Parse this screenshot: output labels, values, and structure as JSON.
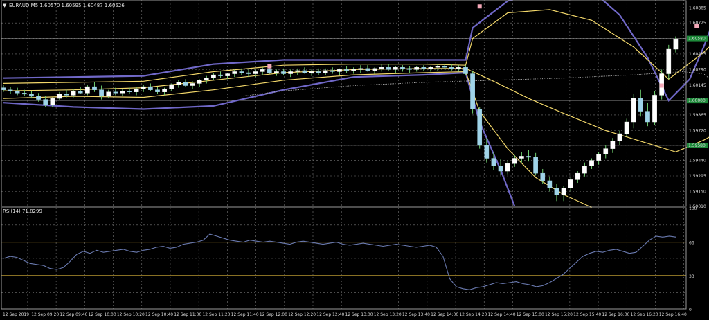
{
  "header": {
    "arrow": "▼",
    "text": "EURAUD,M5  1.60570 1.60595 1.60487 1.60526"
  },
  "rsi_header": {
    "text": "RSI(14) 71.8299"
  },
  "colors": {
    "background": "#000000",
    "grid": "#7a7a7a",
    "bull_candle": "#ffffff",
    "bear_candle": "#9fd3e8",
    "wick": "#6fcf6f",
    "bands_outer": "#7068c8",
    "bands_inner": "#f2d76a",
    "ma_dotted": "#bdbdbd",
    "level_label_bg": "#1e8a3a",
    "rsi_line": "#6a7ab0",
    "rsi_level": "#d9b43a",
    "marker_pink": "#f4a8b8"
  },
  "chart_data": [
    {
      "type": "line",
      "title": "EURAUD,M5",
      "ohlc_last": {
        "open": 1.6057,
        "high": 1.60595,
        "low": 1.60487,
        "close": 1.60526
      },
      "y_ticks": [
        "1.60865",
        "1.60725",
        "1.60580",
        "1.60435",
        "1.60290",
        "1.60145",
        "1.60000",
        "1.59865",
        "1.59720",
        "1.59580",
        "1.59440",
        "1.59295",
        "1.59150",
        "1.59010"
      ],
      "level_labels": [
        "1.60580",
        "1.60000",
        "1.59580"
      ],
      "ylim": [
        1.5901,
        1.6094
      ],
      "x_ticks": [
        "12 Sep 2019",
        "12 Sep 09:20",
        "12 Sep 09:40",
        "12 Sep 10:00",
        "12 Sep 10:20",
        "12 Sep 10:40",
        "12 Sep 11:00",
        "12 Sep 11:20",
        "12 Sep 11:40",
        "12 Sep 12:00",
        "12 Sep 12:20",
        "12 Sep 12:40",
        "12 Sep 13:00",
        "12 Sep 13:20",
        "12 Sep 13:40",
        "12 Sep 14:00",
        "12 Sep 14:20",
        "12 Sep 14:40",
        "12 Sep 15:00",
        "12 Sep 15:20",
        "12 Sep 15:40",
        "12 Sep 16:00",
        "12 Sep 16:20",
        "12 Sep 16:40"
      ],
      "candles": [
        [
          1.6012,
          1.6015,
          1.6008,
          1.601
        ],
        [
          1.601,
          1.6013,
          1.6006,
          1.6009
        ],
        [
          1.6009,
          1.6012,
          1.6005,
          1.6007
        ],
        [
          1.6007,
          1.601,
          1.6004,
          1.6006
        ],
        [
          1.6006,
          1.6009,
          1.6002,
          1.6004
        ],
        [
          1.6004,
          1.6007,
          1.5999,
          1.6001
        ],
        [
          1.6001,
          1.6004,
          1.5994,
          1.5996
        ],
        [
          1.5996,
          1.6003,
          1.5994,
          1.6002
        ],
        [
          1.6002,
          1.6008,
          1.6,
          1.6006
        ],
        [
          1.6006,
          1.601,
          1.6003,
          1.6005
        ],
        [
          1.6005,
          1.6011,
          1.6003,
          1.6009
        ],
        [
          1.6009,
          1.6013,
          1.6006,
          1.6007
        ],
        [
          1.6007,
          1.6015,
          1.6005,
          1.6013
        ],
        [
          1.6013,
          1.6017,
          1.6008,
          1.601
        ],
        [
          1.601,
          1.6014,
          1.6001,
          1.6004
        ],
        [
          1.6004,
          1.601,
          1.6002,
          1.6008
        ],
        [
          1.6008,
          1.6012,
          1.6005,
          1.6007
        ],
        [
          1.6007,
          1.6011,
          1.6004,
          1.6009
        ],
        [
          1.6009,
          1.6012,
          1.6006,
          1.6008
        ],
        [
          1.6008,
          1.6013,
          1.6005,
          1.6011
        ],
        [
          1.6011,
          1.6015,
          1.6008,
          1.6013
        ],
        [
          1.6013,
          1.6016,
          1.6009,
          1.601
        ],
        [
          1.601,
          1.6013,
          1.6006,
          1.6008
        ],
        [
          1.6008,
          1.6012,
          1.6005,
          1.6011
        ],
        [
          1.6011,
          1.6016,
          1.6009,
          1.6015
        ],
        [
          1.6015,
          1.6019,
          1.6012,
          1.6017
        ],
        [
          1.6017,
          1.602,
          1.6013,
          1.6014
        ],
        [
          1.6014,
          1.6018,
          1.6011,
          1.6016
        ],
        [
          1.6016,
          1.602,
          1.6013,
          1.6019
        ],
        [
          1.6019,
          1.6023,
          1.6016,
          1.6021
        ],
        [
          1.6021,
          1.6026,
          1.6019,
          1.6024
        ],
        [
          1.6024,
          1.6027,
          1.6021,
          1.6023
        ],
        [
          1.6023,
          1.6026,
          1.602,
          1.6025
        ],
        [
          1.6025,
          1.6029,
          1.6022,
          1.6027
        ],
        [
          1.6027,
          1.603,
          1.6024,
          1.6026
        ],
        [
          1.6026,
          1.6029,
          1.6022,
          1.6025
        ],
        [
          1.6025,
          1.6029,
          1.6022,
          1.6027
        ],
        [
          1.6027,
          1.6031,
          1.6024,
          1.6029
        ],
        [
          1.6029,
          1.6032,
          1.6025,
          1.6026
        ],
        [
          1.6026,
          1.6029,
          1.6023,
          1.6027
        ],
        [
          1.6027,
          1.603,
          1.6024,
          1.6025
        ],
        [
          1.6025,
          1.6029,
          1.6022,
          1.6027
        ],
        [
          1.6027,
          1.603,
          1.6024,
          1.6028
        ],
        [
          1.6028,
          1.6031,
          1.6025,
          1.6026
        ],
        [
          1.6026,
          1.6029,
          1.6023,
          1.6027
        ],
        [
          1.6027,
          1.603,
          1.6024,
          1.6026
        ],
        [
          1.6026,
          1.603,
          1.6024,
          1.6028
        ],
        [
          1.6028,
          1.6031,
          1.6025,
          1.6027
        ],
        [
          1.6027,
          1.603,
          1.6024,
          1.6029
        ],
        [
          1.6029,
          1.6032,
          1.6026,
          1.6028
        ],
        [
          1.6028,
          1.6031,
          1.6025,
          1.6029
        ],
        [
          1.6029,
          1.6033,
          1.6026,
          1.603
        ],
        [
          1.603,
          1.6033,
          1.6027,
          1.6028
        ],
        [
          1.6028,
          1.6031,
          1.6025,
          1.603
        ],
        [
          1.603,
          1.6034,
          1.6027,
          1.6031
        ],
        [
          1.6031,
          1.6034,
          1.6028,
          1.6029
        ],
        [
          1.6029,
          1.6032,
          1.6026,
          1.6031
        ],
        [
          1.6031,
          1.6033,
          1.6027,
          1.603
        ],
        [
          1.603,
          1.6032,
          1.6026,
          1.6029
        ],
        [
          1.6029,
          1.6032,
          1.6027,
          1.6031
        ],
        [
          1.6031,
          1.6033,
          1.6028,
          1.603
        ],
        [
          1.603,
          1.6032,
          1.6027,
          1.6031
        ],
        [
          1.6031,
          1.6034,
          1.6028,
          1.6032
        ],
        [
          1.6032,
          1.6034,
          1.6029,
          1.6031
        ],
        [
          1.6031,
          1.6034,
          1.6028,
          1.603
        ],
        [
          1.603,
          1.6033,
          1.6027,
          1.6031
        ],
        [
          1.6031,
          1.6033,
          1.6024,
          1.6025
        ],
        [
          1.6025,
          1.6028,
          1.5988,
          1.5992
        ],
        [
          1.5992,
          1.5994,
          1.5955,
          1.5958
        ],
        [
          1.5958,
          1.5965,
          1.5942,
          1.5946
        ],
        [
          1.5946,
          1.5952,
          1.5935,
          1.5939
        ],
        [
          1.5939,
          1.5945,
          1.593,
          1.5934
        ],
        [
          1.5934,
          1.5944,
          1.5931,
          1.5941
        ],
        [
          1.5941,
          1.5949,
          1.5938,
          1.5946
        ],
        [
          1.5946,
          1.5952,
          1.5942,
          1.5948
        ],
        [
          1.5948,
          1.5954,
          1.5943,
          1.5947
        ],
        [
          1.5947,
          1.5951,
          1.593,
          1.5932
        ],
        [
          1.5932,
          1.5936,
          1.5922,
          1.5925
        ],
        [
          1.5925,
          1.5929,
          1.5915,
          1.5918
        ],
        [
          1.5918,
          1.5922,
          1.5906,
          1.5912
        ],
        [
          1.5912,
          1.592,
          1.5906,
          1.5918
        ],
        [
          1.5918,
          1.5928,
          1.5915,
          1.5926
        ],
        [
          1.5926,
          1.5934,
          1.5923,
          1.5932
        ],
        [
          1.5932,
          1.5942,
          1.5929,
          1.5939
        ],
        [
          1.5939,
          1.5946,
          1.5936,
          1.5944
        ],
        [
          1.5944,
          1.5952,
          1.594,
          1.595
        ],
        [
          1.595,
          1.5958,
          1.5946,
          1.5955
        ],
        [
          1.5955,
          1.5965,
          1.5951,
          1.5962
        ],
        [
          1.5962,
          1.5972,
          1.5958,
          1.5969
        ],
        [
          1.5969,
          1.5983,
          1.5966,
          1.598
        ],
        [
          1.598,
          1.6006,
          1.5974,
          1.6002
        ],
        [
          1.6002,
          1.601,
          1.5985,
          1.599
        ],
        [
          1.599,
          1.5998,
          1.5976,
          1.598
        ],
        [
          1.598,
          1.6009,
          1.5977,
          1.6005
        ],
        [
          1.6005,
          1.6029,
          1.6001,
          1.6025
        ],
        [
          1.6025,
          1.6052,
          1.602,
          1.6048
        ],
        [
          1.6048,
          1.606,
          1.6045,
          1.6057
        ]
      ],
      "bands": {
        "outer_upper": [
          [
            0,
            1.6021
          ],
          [
            10,
            1.6022
          ],
          [
            20,
            1.6023
          ],
          [
            30,
            1.6034
          ],
          [
            40,
            1.6038
          ],
          [
            50,
            1.6038
          ],
          [
            60,
            1.6038
          ],
          [
            66,
            1.6038
          ],
          [
            67,
            1.6068
          ],
          [
            72,
            1.6093
          ],
          [
            78,
            1.6106
          ],
          [
            84,
            1.6103
          ],
          [
            88,
            1.608
          ],
          [
            92,
            1.604
          ],
          [
            95,
            1.6
          ],
          [
            98,
            1.602
          ],
          [
            100,
            1.605
          ],
          [
            102,
            1.6085
          ]
        ],
        "inner_upper": [
          [
            0,
            1.6016
          ],
          [
            10,
            1.6017
          ],
          [
            20,
            1.6018
          ],
          [
            30,
            1.6027
          ],
          [
            40,
            1.6033
          ],
          [
            50,
            1.6034
          ],
          [
            60,
            1.6034
          ],
          [
            66,
            1.6033
          ],
          [
            67,
            1.6058
          ],
          [
            72,
            1.6082
          ],
          [
            78,
            1.6085
          ],
          [
            84,
            1.6075
          ],
          [
            90,
            1.605
          ],
          [
            95,
            1.602
          ],
          [
            98,
            1.6035
          ],
          [
            100,
            1.6045
          ],
          [
            102,
            1.6058
          ]
        ],
        "middle": [
          [
            0,
            1.6009
          ],
          [
            10,
            1.601
          ],
          [
            20,
            1.6012
          ],
          [
            30,
            1.6019
          ],
          [
            40,
            1.6026
          ],
          [
            50,
            1.6029
          ],
          [
            60,
            1.603
          ],
          [
            66,
            1.603
          ],
          [
            70,
            1.6018
          ],
          [
            75,
            1.6002
          ],
          [
            80,
            1.5988
          ],
          [
            86,
            1.5972
          ],
          [
            92,
            1.596
          ],
          [
            96,
            1.5952
          ],
          [
            100,
            1.5963
          ],
          [
            102,
            1.597
          ]
        ],
        "inner_lower": [
          [
            0,
            1.6002
          ],
          [
            10,
            1.6004
          ],
          [
            20,
            1.6003
          ],
          [
            30,
            1.601
          ],
          [
            40,
            1.6019
          ],
          [
            50,
            1.6024
          ],
          [
            60,
            1.6026
          ],
          [
            66,
            1.6027
          ],
          [
            68,
            1.599
          ],
          [
            72,
            1.5955
          ],
          [
            76,
            1.5928
          ],
          [
            80,
            1.5912
          ],
          [
            84,
            1.59
          ]
        ],
        "outer_lower": [
          [
            0,
            1.5998
          ],
          [
            10,
            1.5994
          ],
          [
            20,
            1.5992
          ],
          [
            30,
            1.5995
          ],
          [
            40,
            1.601
          ],
          [
            50,
            1.6022
          ],
          [
            60,
            1.6024
          ],
          [
            66,
            1.6026
          ],
          [
            68,
            1.598
          ],
          [
            71,
            1.5935
          ],
          [
            73,
            1.5901
          ]
        ],
        "ma_dotted": [
          [
            34,
            1.6004
          ],
          [
            40,
            1.6009
          ],
          [
            50,
            1.6014
          ],
          [
            60,
            1.6017
          ],
          [
            70,
            1.6019
          ],
          [
            80,
            1.6021
          ],
          [
            90,
            1.6024
          ],
          [
            97,
            1.6027
          ],
          [
            100,
            1.6025
          ],
          [
            102,
            1.6014
          ]
        ]
      },
      "markers": [
        [
          68,
          1.6088
        ],
        [
          38,
          1.6032
        ],
        [
          94,
          1.6014
        ],
        [
          99,
          1.607
        ]
      ]
    },
    {
      "type": "line",
      "title": "RSI(14) 71.8299",
      "ylim": [
        0,
        100
      ],
      "y_ticks": [
        "100",
        "66",
        "33",
        "0"
      ],
      "levels": [
        66,
        33
      ],
      "values": [
        50,
        52,
        51,
        48,
        45,
        44,
        43,
        40,
        39,
        41,
        47,
        54,
        57,
        55,
        58,
        56,
        57,
        58,
        59,
        57,
        56,
        58,
        59,
        61,
        62,
        60,
        61,
        64,
        65,
        66,
        68,
        74,
        72,
        70,
        68,
        67,
        66,
        68,
        67,
        66,
        67,
        66,
        65,
        64,
        66,
        67,
        66,
        65,
        64,
        65,
        66,
        64,
        63,
        64,
        65,
        64,
        63,
        62,
        63,
        64,
        63,
        62,
        61,
        62,
        63,
        61,
        52,
        30,
        22,
        20,
        19,
        21,
        22,
        24,
        26,
        25,
        26,
        27,
        25,
        24,
        22,
        23,
        26,
        30,
        34,
        40,
        46,
        52,
        55,
        57,
        56,
        58,
        59,
        57,
        55,
        56,
        62,
        68,
        72,
        71,
        72,
        71
      ]
    }
  ]
}
